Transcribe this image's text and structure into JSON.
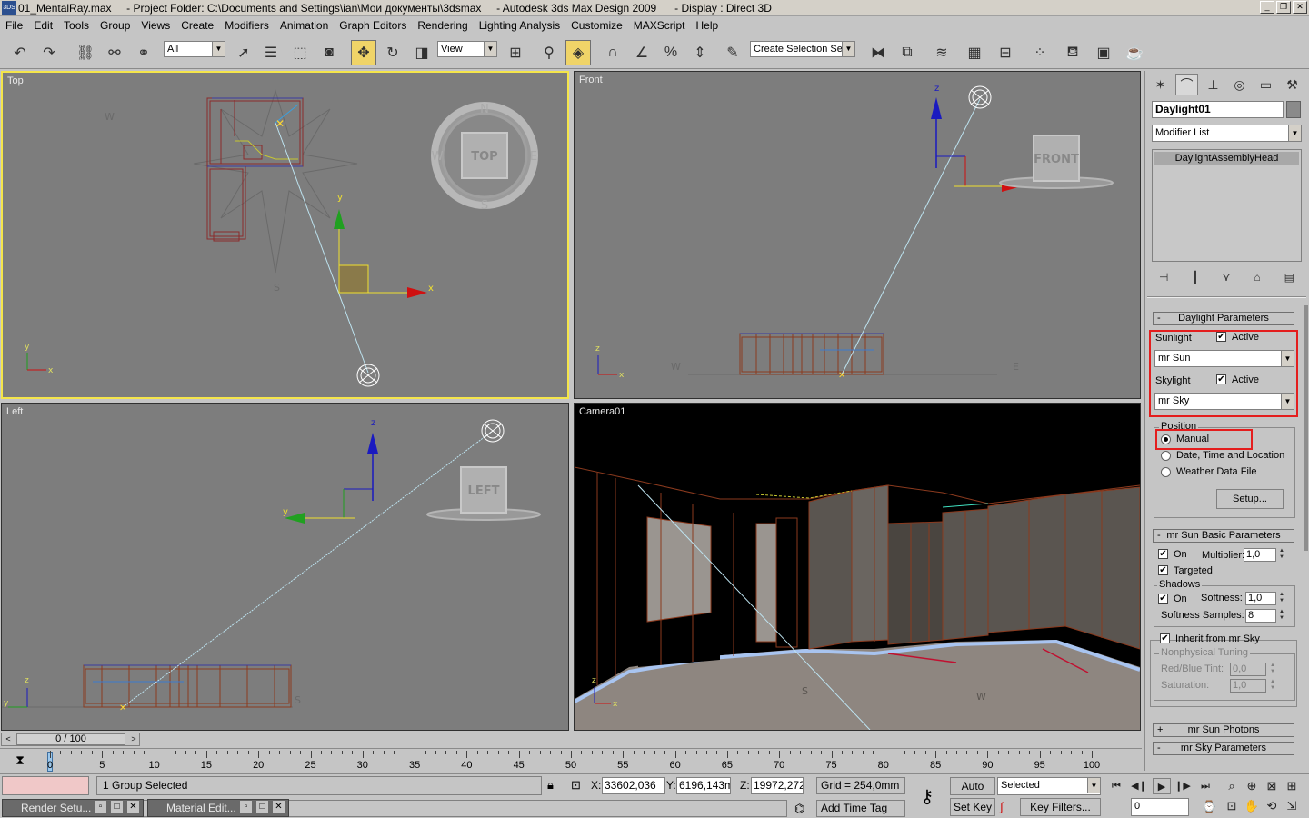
{
  "window": {
    "title": "01_MentalRay.max     - Project Folder: C:\\Documents and Settings\\ian\\Мои документы\\3dsmax     - Autodesk 3ds Max Design 2009      - Display : Direct 3D",
    "app_icon_text": "3DS",
    "controls": [
      "_",
      "❐",
      "✕"
    ]
  },
  "menu": [
    "File",
    "Edit",
    "Tools",
    "Group",
    "Views",
    "Create",
    "Modifiers",
    "Animation",
    "Graph Editors",
    "Rendering",
    "Lighting Analysis",
    "Customize",
    "MAXScript",
    "Help"
  ],
  "toolbar": {
    "selection_filter": "All",
    "ref_coord": "View",
    "named_selection": "Create Selection Set"
  },
  "viewports": {
    "top": {
      "label": "Top",
      "viewcube": "TOP",
      "compass": [
        "N",
        "S",
        "E",
        "W"
      ]
    },
    "front": {
      "label": "Front",
      "viewcube": "FRONT"
    },
    "left": {
      "label": "Left",
      "viewcube": "LEFT"
    },
    "camera": {
      "label": "Camera01"
    },
    "axis": {
      "x": "x",
      "y": "y",
      "z": "z"
    },
    "markers": {
      "w": "W",
      "e": "E",
      "s": "S"
    }
  },
  "command_panel": {
    "object_name": "Daylight01",
    "modifier_list": "Modifier List",
    "stack_item": "DaylightAssemblyHead",
    "daylight_params": {
      "title": "Daylight Parameters",
      "sunlight_label": "Sunlight",
      "sunlight_active_label": "Active",
      "sunlight_active": true,
      "sunlight_type": "mr Sun",
      "skylight_label": "Skylight",
      "skylight_active_label": "Active",
      "skylight_active": true,
      "skylight_type": "mr Sky",
      "position_group": "Position",
      "position_options": [
        "Manual",
        "Date, Time and Location",
        "Weather Data File"
      ],
      "position_selected": "Manual",
      "setup_button": "Setup..."
    },
    "mr_sun_basic": {
      "title": "mr Sun Basic Parameters",
      "on_label": "On",
      "multiplier_label": "Multiplier:",
      "multiplier": "1,0",
      "targeted_label": "Targeted",
      "shadows_group": "Shadows",
      "shadows_on_label": "On",
      "softness_label": "Softness:",
      "softness": "1,0",
      "softness_samples_label": "Softness Samples:",
      "softness_samples": "8",
      "inherit_label": "Inherit from mr Sky",
      "nonphysical_group": "Nonphysical Tuning",
      "redblue_label": "Red/Blue Tint:",
      "redblue": "0,0",
      "saturation_label": "Saturation:",
      "saturation": "1,0"
    },
    "collapsed_rollouts": [
      {
        "sign": "+",
        "title": "mr Sun Photons"
      },
      {
        "sign": "-",
        "title": "mr Sky Parameters"
      }
    ]
  },
  "timeslider": {
    "position": "0 / 100",
    "prev": "<",
    "next": ">"
  },
  "trackbar": {
    "ticks": [
      "0",
      "5",
      "10",
      "15",
      "20",
      "25",
      "30",
      "35",
      "40",
      "45",
      "50",
      "55",
      "60",
      "65",
      "70",
      "75",
      "80",
      "85",
      "90",
      "95",
      "100"
    ]
  },
  "status": {
    "selection": "1 Group Selected",
    "x_label": "X:",
    "x_value": "33602,036",
    "y_label": "Y:",
    "y_value": "6196,143m",
    "z_label": "Z:",
    "z_value": "19972,272",
    "grid": "Grid = 254,0mm",
    "add_time_tag": "Add Time Tag",
    "auto_key": "Auto Key",
    "set_key": "Set Key",
    "key_mode": "Selected",
    "key_filters": "Key Filters...",
    "frame": "0"
  },
  "taskbar": {
    "render_setup": "Render Setu...",
    "material_editor": "Material Edit..."
  },
  "colors": {
    "viewport_bg": "#7d7d7d",
    "active_border": "#f4e54a",
    "highlight": "#e41e1e",
    "wire": "#8b3a1e"
  }
}
